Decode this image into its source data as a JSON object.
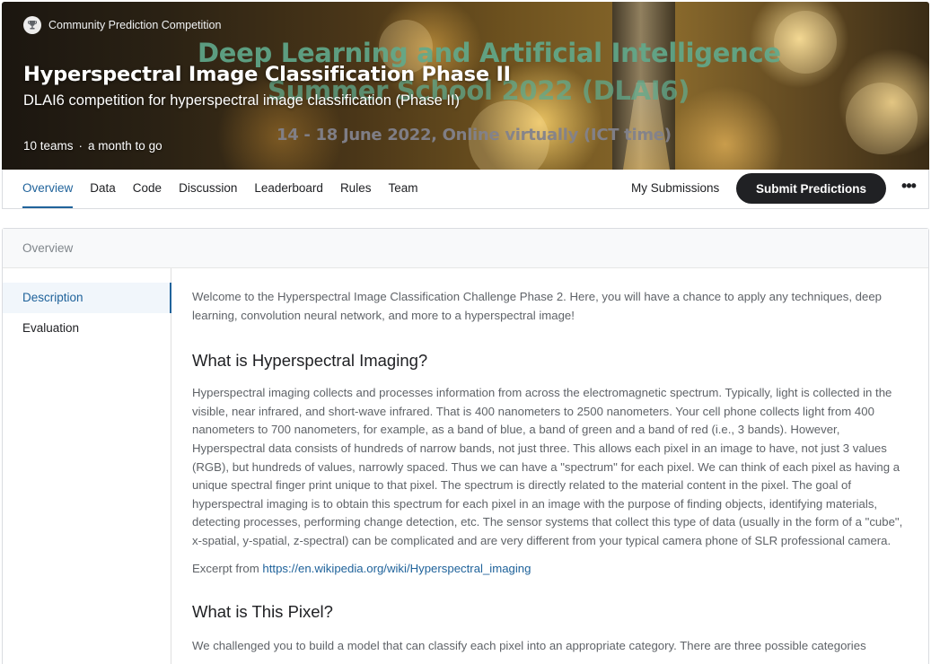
{
  "header": {
    "competition_type": "Community Prediction Competition",
    "title": "Hyperspectral Image Classification Phase II",
    "subtitle": "DLAI6 competition for hyperspectral image classification (Phase II)",
    "teams": "10 teams",
    "separator": "·",
    "deadline": "a month to go",
    "banner_text": {
      "line1": "Deep Learning and Artificial Intelligence",
      "line2": "Summer School 2022 (DLAI6)",
      "line3": "14 - 18 June 2022, Online virtually (ICT time)"
    }
  },
  "tabs": [
    {
      "label": "Overview",
      "active": true
    },
    {
      "label": "Data",
      "active": false
    },
    {
      "label": "Code",
      "active": false
    },
    {
      "label": "Discussion",
      "active": false
    },
    {
      "label": "Leaderboard",
      "active": false
    },
    {
      "label": "Rules",
      "active": false
    },
    {
      "label": "Team",
      "active": false
    }
  ],
  "actions": {
    "my_submissions": "My Submissions",
    "submit": "Submit Predictions",
    "more": "•••"
  },
  "panel": {
    "heading": "Overview",
    "sidenav": [
      {
        "label": "Description",
        "active": true
      },
      {
        "label": "Evaluation",
        "active": false
      }
    ]
  },
  "content": {
    "intro": "Welcome to the Hyperspectral Image Classification Challenge Phase 2. Here, you will have a chance to apply any techniques, deep learning, convolution neural network, and more to a hyperspectral image!",
    "section1_title": "What is Hyperspectral Imaging?",
    "section1_body": "Hyperspectral imaging collects and processes information from across the electromagnetic spectrum. Typically, light is collected in the visible, near infrared, and short-wave infrared. That is 400 nanometers to 2500 nanometers. Your cell phone collects light from 400 nanometers to 700 nanometers, for example, as a band of blue, a band of green and a band of red (i.e., 3 bands). However, Hyperspectral data consists of hundreds of narrow bands, not just three. This allows each pixel in an image to have, not just 3 values (RGB), but hundreds of values, narrowly spaced. Thus we can have a \"spectrum\" for each pixel. We can think of each pixel as having a unique spectral finger print unique to that pixel. The spectrum is directly related to the material content in the pixel. The goal of hyperspectral imaging is to obtain this spectrum for each pixel in an image with the purpose of finding objects, identifying materials, detecting processes, performing change detection, etc. The sensor systems that collect this type of data (usually in the form of a \"cube\", x-spatial, y-spatial, z-spectral) can be complicated and are very different from your typical camera phone of SLR professional camera.",
    "excerpt_prefix": "Excerpt from",
    "excerpt_link": "https://en.wikipedia.org/wiki/Hyperspectral_imaging",
    "section2_title": "What is This Pixel?",
    "section2_body": "We challenged you to build a model that can classify each pixel into an appropriate category. There are three possible categories"
  },
  "colors": {
    "accent": "#20639b",
    "dark_button": "#202124",
    "body_text": "#5f6368"
  }
}
